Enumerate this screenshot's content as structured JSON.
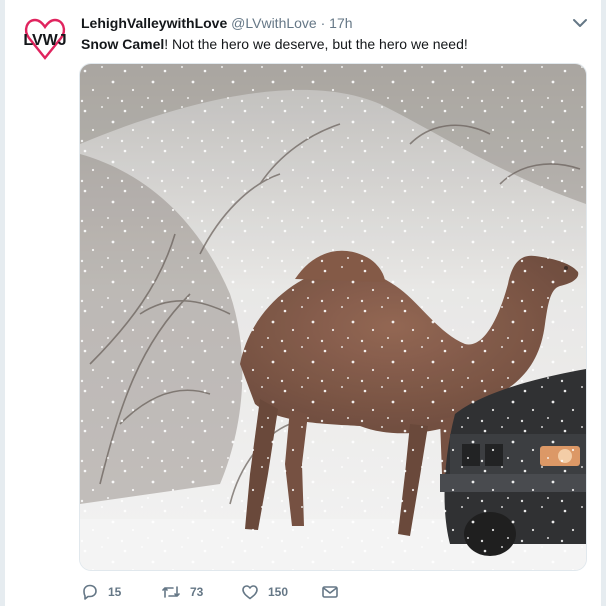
{
  "tweet": {
    "avatar_text": "LVWJ",
    "display_name": "LehighValleywithLove",
    "handle": "@LVwithLove",
    "separator": "·",
    "time": "17h",
    "text_bold": "Snow Camel",
    "text_rest": "! Not the hero we deserve, but the hero we need!",
    "image_alt": "camel walking in snow next to a car",
    "actions": {
      "reply_count": "15",
      "retweet_count": "73",
      "like_count": "150"
    }
  },
  "colors": {
    "heart_red": "#e0245e",
    "icon_gray": "#657786",
    "text_dark": "#14171a"
  },
  "icons": [
    "caret-down-icon",
    "reply-icon",
    "retweet-icon",
    "like-icon",
    "message-icon"
  ]
}
